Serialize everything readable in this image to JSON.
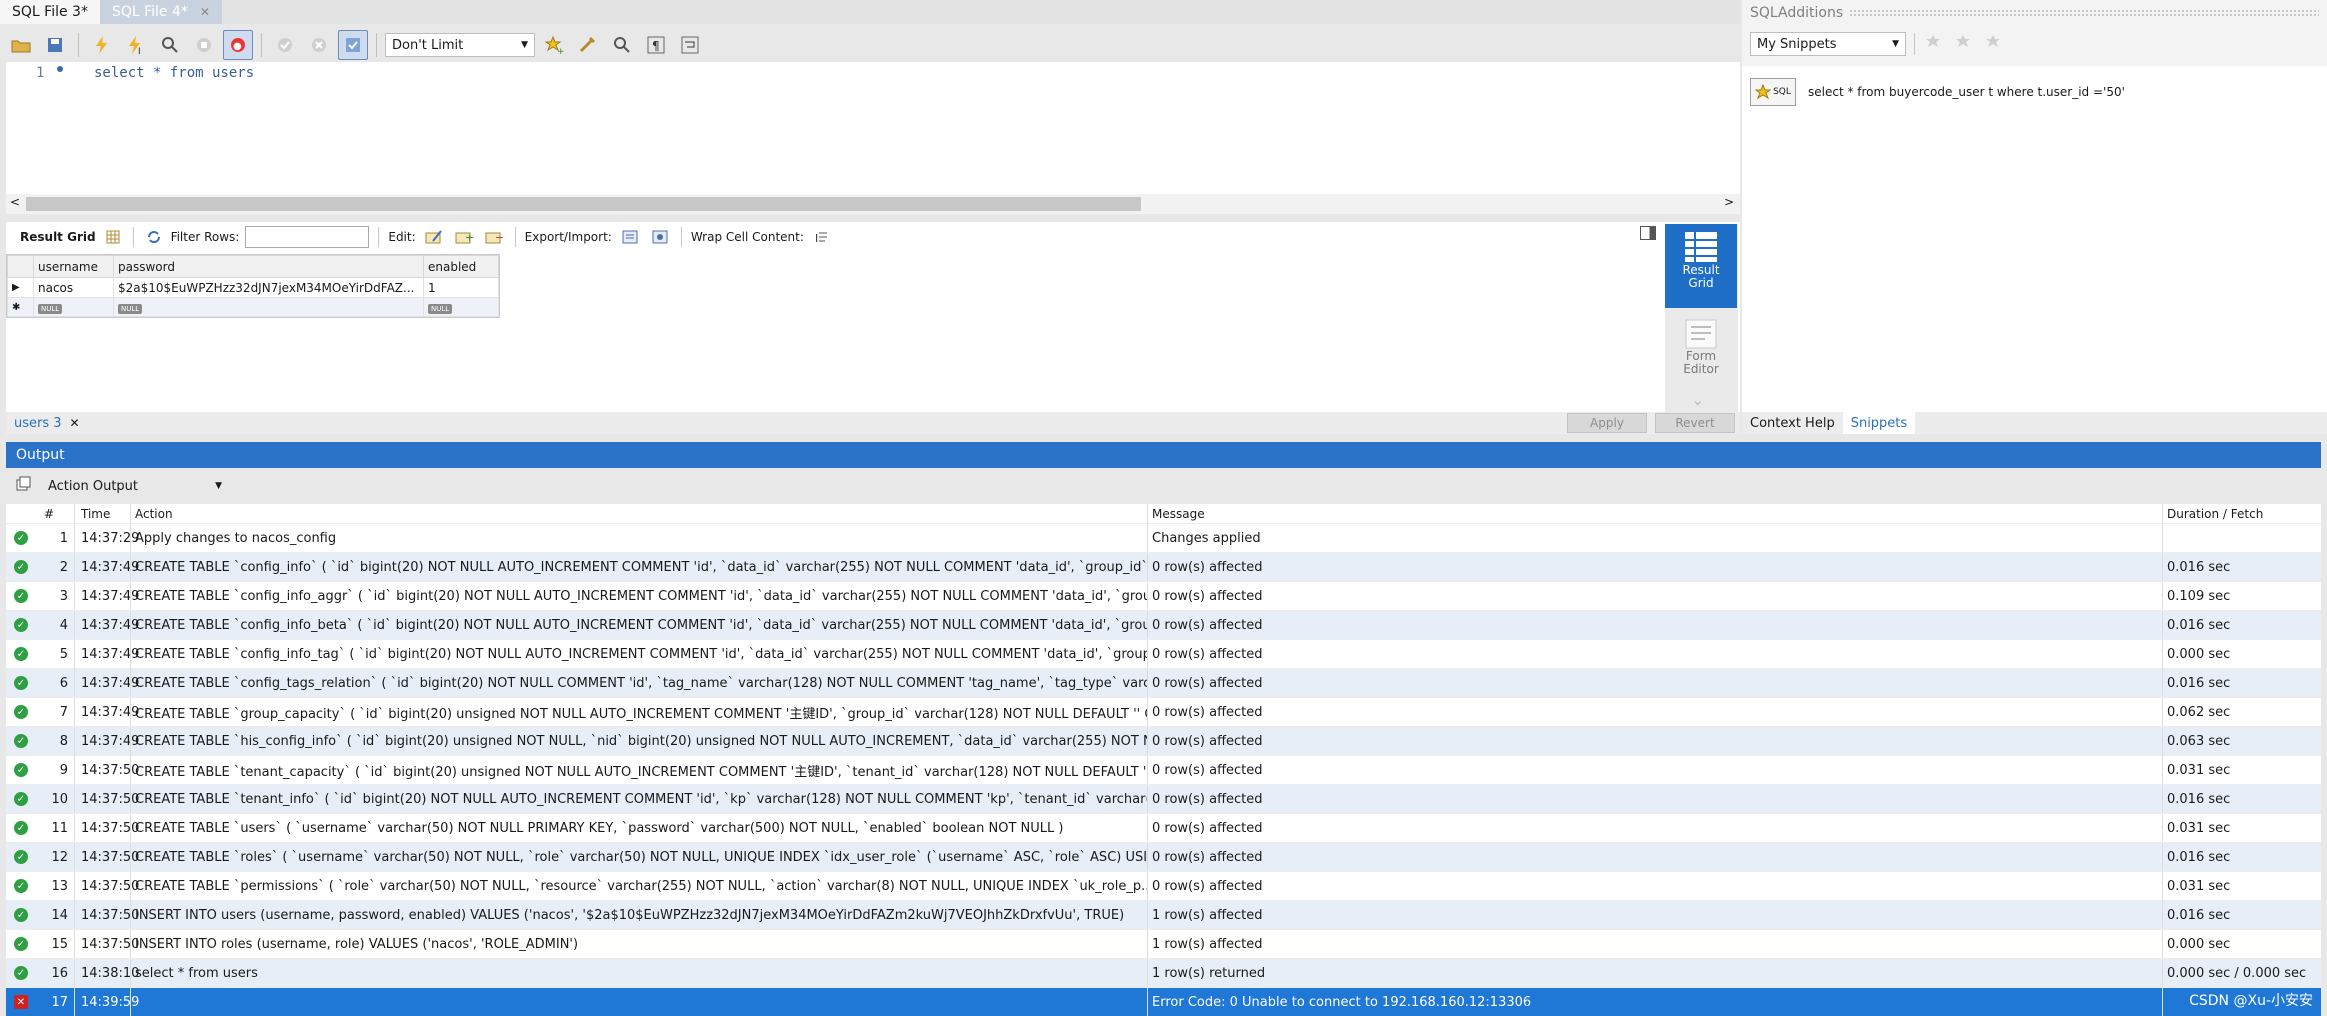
{
  "tabs": [
    {
      "label": "SQL File 3*",
      "active": true
    },
    {
      "label": "SQL File 4*",
      "active": false
    }
  ],
  "toolbar": {
    "limit_select": "Don't Limit"
  },
  "editor": {
    "line_number": "1",
    "code": "select * from users"
  },
  "result_toolbar": {
    "result_grid_label": "Result Grid",
    "filter_rows_label": "Filter Rows:",
    "filter_value": "",
    "edit_label": "Edit:",
    "export_label": "Export/Import:",
    "wrap_label": "Wrap Cell Content:"
  },
  "grid": {
    "columns": [
      "username",
      "password",
      "enabled"
    ],
    "rows": [
      [
        "nacos",
        "$2a$10$EuWPZHzz32dJN7jexM34MOeYirDdFAZ...",
        "1"
      ]
    ],
    "null_label": "NULL"
  },
  "side_buttons": {
    "result_grid": "Result Grid",
    "form_editor": "Form Editor"
  },
  "bottom_tabs": {
    "result_tab": "users 3",
    "apply": "Apply",
    "revert": "Revert"
  },
  "right_panel": {
    "title": "SQLAdditions",
    "snippets_select": "My Snippets",
    "snippet_text": "select * from buyercode_user t where t.user_id ='50'",
    "snippet_badge": "SQL",
    "tabs": [
      "Context Help",
      "Snippets"
    ]
  },
  "output": {
    "title": "Output",
    "mode": "Action Output",
    "headers": {
      "num": "#",
      "time": "Time",
      "action": "Action",
      "message": "Message",
      "duration": "Duration / Fetch"
    },
    "rows": [
      {
        "status": "ok",
        "num": "1",
        "time": "14:37:29",
        "action": "Apply changes to nacos_config",
        "message": "Changes applied",
        "duration": ""
      },
      {
        "status": "ok",
        "num": "2",
        "time": "14:37:49",
        "action": "CREATE TABLE `config_info` (   `id` bigint(20) NOT NULL AUTO_INCREMENT COMMENT 'id',   `data_id` varchar(255) NOT NULL COMMENT 'data_id',   `group_id` va...",
        "message": "0 row(s) affected",
        "duration": "0.016 sec"
      },
      {
        "status": "ok",
        "num": "3",
        "time": "14:37:49",
        "action": "CREATE TABLE `config_info_aggr` (   `id` bigint(20) NOT NULL AUTO_INCREMENT COMMENT 'id',   `data_id` varchar(255) NOT NULL COMMENT 'data_id',   `group_...",
        "message": "0 row(s) affected",
        "duration": "0.109 sec"
      },
      {
        "status": "ok",
        "num": "4",
        "time": "14:37:49",
        "action": "CREATE TABLE `config_info_beta` (   `id` bigint(20) NOT NULL AUTO_INCREMENT COMMENT 'id',   `data_id` varchar(255) NOT NULL COMMENT 'data_id',   `group_...",
        "message": "0 row(s) affected",
        "duration": "0.016 sec"
      },
      {
        "status": "ok",
        "num": "5",
        "time": "14:37:49",
        "action": "CREATE TABLE `config_info_tag` (   `id` bigint(20) NOT NULL AUTO_INCREMENT COMMENT 'id',   `data_id` varchar(255) NOT NULL COMMENT 'data_id',   `group_i...",
        "message": "0 row(s) affected",
        "duration": "0.000 sec"
      },
      {
        "status": "ok",
        "num": "6",
        "time": "14:37:49",
        "action": "CREATE TABLE `config_tags_relation` (   `id` bigint(20) NOT NULL COMMENT 'id',   `tag_name` varchar(128) NOT NULL COMMENT 'tag_name',   `tag_type` varchar(6...",
        "message": "0 row(s) affected",
        "duration": "0.016 sec"
      },
      {
        "status": "ok",
        "num": "7",
        "time": "14:37:49",
        "action": "CREATE TABLE `group_capacity` (   `id` bigint(20) unsigned NOT NULL AUTO_INCREMENT COMMENT '主键ID',   `group_id` varchar(128) NOT NULL DEFAULT '' C...",
        "message": "0 row(s) affected",
        "duration": "0.062 sec"
      },
      {
        "status": "ok",
        "num": "8",
        "time": "14:37:49",
        "action": "CREATE TABLE `his_config_info` (   `id` bigint(20) unsigned NOT NULL,   `nid` bigint(20) unsigned NOT NULL AUTO_INCREMENT,   `data_id` varchar(255) NOT NULL,...",
        "message": "0 row(s) affected",
        "duration": "0.063 sec"
      },
      {
        "status": "ok",
        "num": "9",
        "time": "14:37:50",
        "action": "CREATE TABLE `tenant_capacity` (   `id` bigint(20) unsigned NOT NULL AUTO_INCREMENT COMMENT '主键ID',   `tenant_id` varchar(128) NOT NULL DEFAULT '' C...",
        "message": "0 row(s) affected",
        "duration": "0.031 sec"
      },
      {
        "status": "ok",
        "num": "10",
        "time": "14:37:50",
        "action": "CREATE TABLE `tenant_info` (   `id` bigint(20) NOT NULL AUTO_INCREMENT COMMENT 'id',   `kp` varchar(128) NOT NULL COMMENT 'kp',   `tenant_id` varchar(12...",
        "message": "0 row(s) affected",
        "duration": "0.016 sec"
      },
      {
        "status": "ok",
        "num": "11",
        "time": "14:37:50",
        "action": "CREATE TABLE `users` ( `username` varchar(50) NOT NULL PRIMARY KEY, `password` varchar(500) NOT NULL, `enabled` boolean NOT NULL )",
        "message": "0 row(s) affected",
        "duration": "0.031 sec"
      },
      {
        "status": "ok",
        "num": "12",
        "time": "14:37:50",
        "action": "CREATE TABLE `roles` ( `username` varchar(50) NOT NULL, `role` varchar(50) NOT NULL, UNIQUE INDEX `idx_user_role` (`username` ASC, `role` ASC) USING BTREE )",
        "message": "0 row(s) affected",
        "duration": "0.016 sec"
      },
      {
        "status": "ok",
        "num": "13",
        "time": "14:37:50",
        "action": "CREATE TABLE `permissions` (     `role` varchar(50) NOT NULL,     `resource` varchar(255) NOT NULL,     `action` varchar(8) NOT NULL,     UNIQUE INDEX `uk_role_p...",
        "message": "0 row(s) affected",
        "duration": "0.031 sec"
      },
      {
        "status": "ok",
        "num": "14",
        "time": "14:37:50",
        "action": "INSERT INTO users (username, password, enabled) VALUES ('nacos', '$2a$10$EuWPZHzz32dJN7jexM34MOeYirDdFAZm2kuWj7VEOJhhZkDrxfvUu', TRUE)",
        "message": "1 row(s) affected",
        "duration": "0.016 sec"
      },
      {
        "status": "ok",
        "num": "15",
        "time": "14:37:50",
        "action": "INSERT INTO roles (username, role) VALUES ('nacos', 'ROLE_ADMIN')",
        "message": "1 row(s) affected",
        "duration": "0.000 sec"
      },
      {
        "status": "ok",
        "num": "16",
        "time": "14:38:10",
        "action": "select * from users",
        "message": "1 row(s) returned",
        "duration": "0.000 sec / 0.000 sec"
      },
      {
        "status": "error",
        "num": "17",
        "time": "14:39:59",
        "action": "",
        "message": "Error Code: 0 Unable to connect to 192.168.160.12:13306",
        "duration": ""
      }
    ]
  },
  "watermark": "CSDN @Xu-小安安",
  "colors": {
    "accent": "#2b73c8",
    "ok": "#2ea043",
    "error": "#d21f1f",
    "selected_row": "#1f78d6"
  }
}
